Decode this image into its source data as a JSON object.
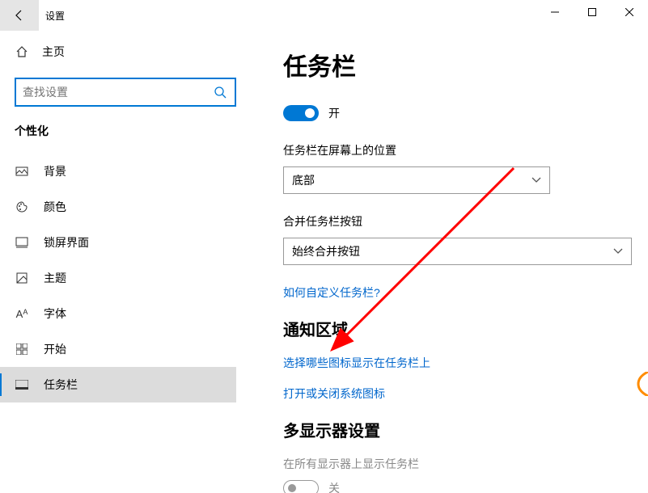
{
  "app": {
    "title": "设置"
  },
  "sidebar": {
    "home": "主页",
    "searchPlaceholder": "查找设置",
    "section": "个性化",
    "items": [
      {
        "label": "背景"
      },
      {
        "label": "颜色"
      },
      {
        "label": "锁屏界面"
      },
      {
        "label": "主题"
      },
      {
        "label": "字体"
      },
      {
        "label": "开始"
      },
      {
        "label": "任务栏"
      }
    ]
  },
  "page": {
    "title": "任务栏",
    "toggle1": {
      "state": "开"
    },
    "position": {
      "label": "任务栏在屏幕上的位置",
      "value": "底部"
    },
    "combine": {
      "label": "合并任务栏按钮",
      "value": "始终合并按钮"
    },
    "customizeLink": "如何自定义任务栏?",
    "notifArea": {
      "heading": "通知区域",
      "link1": "选择哪些图标显示在任务栏上",
      "link2": "打开或关闭系统图标"
    },
    "multiMonitor": {
      "heading": "多显示器设置",
      "label": "在所有显示器上显示任务栏",
      "state": "关"
    }
  }
}
